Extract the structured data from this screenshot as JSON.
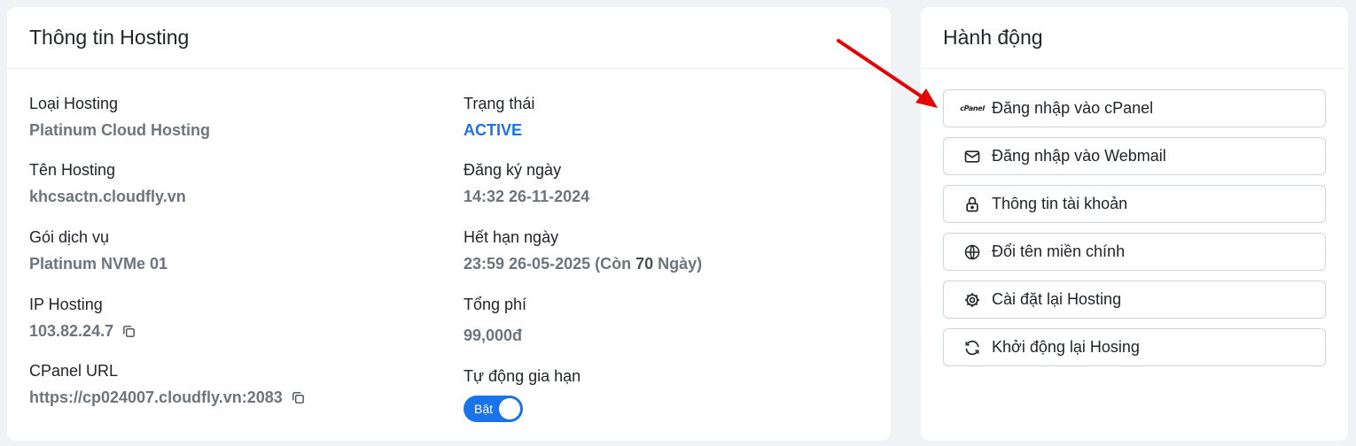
{
  "info": {
    "title": "Thông tin Hosting",
    "fields": [
      {
        "label": "Loại Hosting",
        "value": "Platinum Cloud Hosting"
      },
      {
        "label": "Tên Hosting",
        "value": "khcsactn.cloudfly.vn"
      },
      {
        "label": "Gói dịch vụ",
        "value": "Platinum NVMe 01"
      },
      {
        "label": "IP Hosting",
        "value": "103.82.24.7"
      },
      {
        "label": "CPanel URL",
        "value": "https://cp024007.cloudfly.vn:2083"
      },
      {
        "label": "Trạng thái",
        "value": "ACTIVE"
      },
      {
        "label": "Đăng ký ngày",
        "value": "14:32 26-11-2024"
      },
      {
        "label": "Hết hạn ngày",
        "value": "23:59 26-05-2025 (Còn ",
        "days": "70",
        "suffix": " Ngày)"
      },
      {
        "label": "Tổng phí",
        "value": "99,000đ"
      },
      {
        "label": "Tự động gia hạn",
        "toggle_label": "Bật",
        "toggle_on": true
      }
    ]
  },
  "actions": {
    "title": "Hành động",
    "buttons": [
      {
        "label": "Đăng nhập vào cPanel",
        "icon": "cpanel-icon",
        "icon_text": "cPanel"
      },
      {
        "label": "Đăng nhập vào Webmail",
        "icon": "mail-icon"
      },
      {
        "label": "Thông tin tài khoản",
        "icon": "lock-icon"
      },
      {
        "label": "Đổi tên miền chính",
        "icon": "globe-www-icon"
      },
      {
        "label": "Cài đặt lại Hosting",
        "icon": "gear-icon"
      },
      {
        "label": "Khởi động lại Hosing",
        "icon": "refresh-icon"
      }
    ]
  },
  "colors": {
    "accent": "#1a73e8",
    "annotation_arrow": "#e60000",
    "muted_value": "#6c757d"
  }
}
